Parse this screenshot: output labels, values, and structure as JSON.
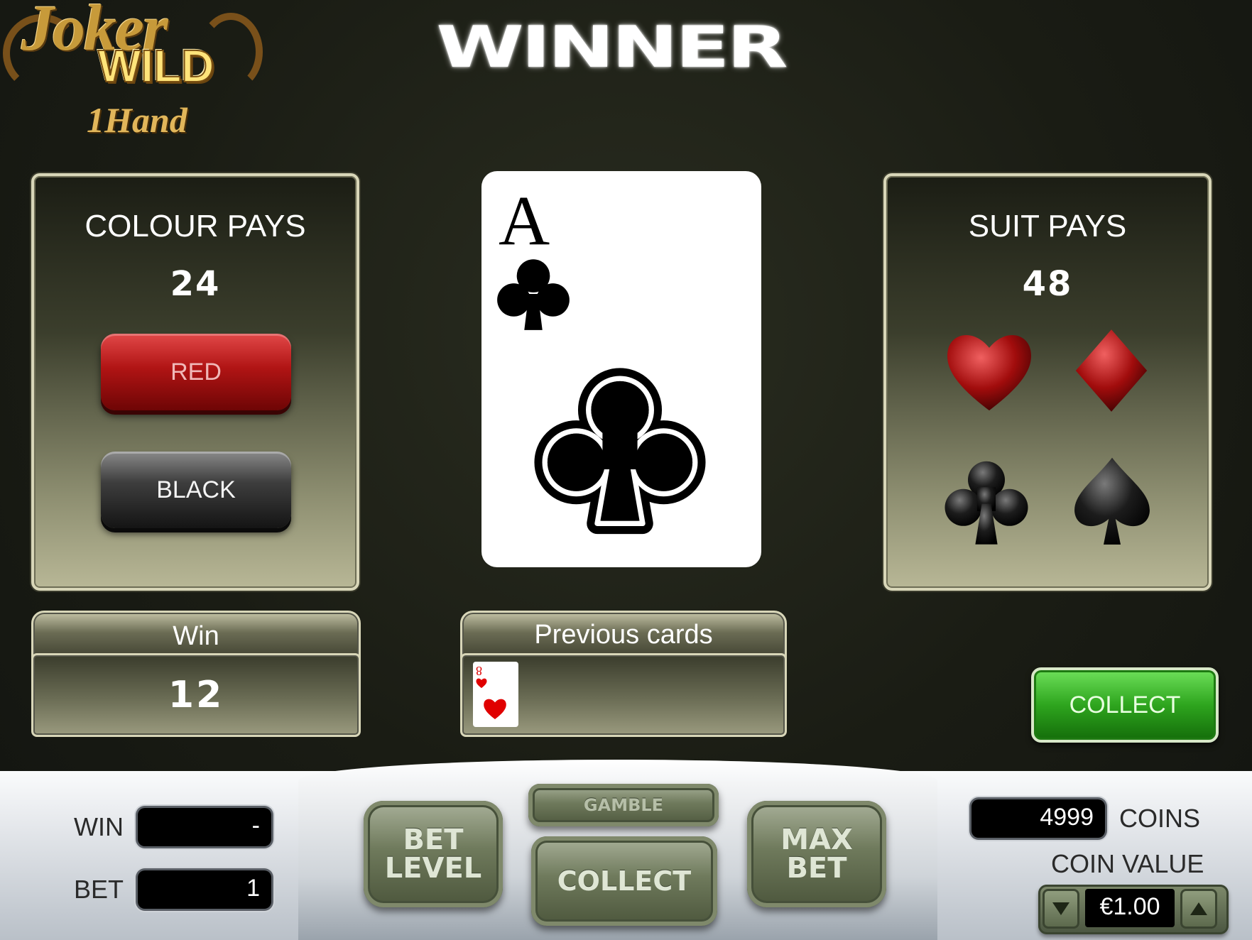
{
  "logo": {
    "line1": "Joker",
    "line2": "WILD",
    "line3": "1Hand"
  },
  "banner": "WINNER",
  "colour_panel": {
    "title": "COLOUR PAYS",
    "value": "24",
    "red_label": "RED",
    "black_label": "BLACK"
  },
  "suit_panel": {
    "title": "SUIT PAYS",
    "value": "48",
    "suits": [
      "heart-icon",
      "diamond-icon",
      "club-icon",
      "spade-icon"
    ]
  },
  "card": {
    "rank": "A",
    "suit": "club-icon"
  },
  "win_panel": {
    "label": "Win",
    "value": "12"
  },
  "previous_cards": {
    "label": "Previous cards",
    "cards": [
      {
        "rank": "8",
        "suit": "heart-icon"
      }
    ]
  },
  "collect_green": "COLLECT",
  "console": {
    "win_label": "WIN",
    "win_value": "-",
    "bet_label": "BET",
    "bet_value": "1",
    "bet_level": "BET LEVEL",
    "gamble": "GAMBLE",
    "collect": "COLLECT",
    "max_bet": "MAX BET",
    "coins_value": "4999",
    "coins_label": "COINS",
    "coin_value_label": "COIN VALUE",
    "coin_value": "€1.00"
  },
  "colors": {
    "red": "#b01414",
    "green": "#2ea51e",
    "panel_border": "#d8d6b8"
  }
}
